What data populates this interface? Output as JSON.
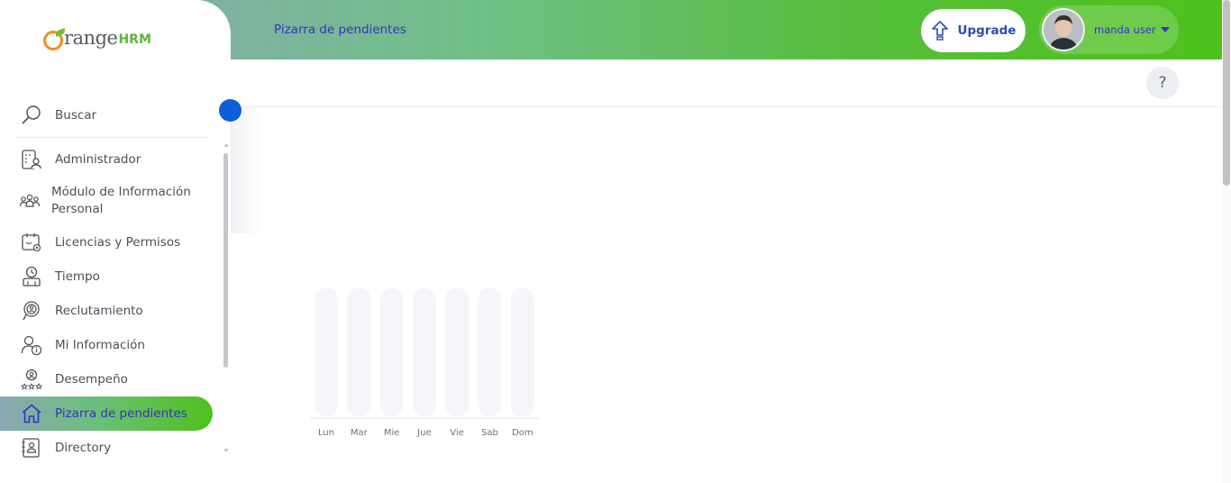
{
  "topbar": {
    "title": "Pizarra de pendientes",
    "upgrade_label": "Upgrade",
    "user_name": "manda user"
  },
  "help": {
    "label": "?"
  },
  "logo": {
    "part1": "range",
    "part2": "HRM"
  },
  "sidebar": {
    "search_label": "Buscar",
    "items": [
      {
        "label": "Administrador",
        "icon": "admin-icon"
      },
      {
        "label": "Módulo de Información Personal",
        "icon": "pim-icon"
      },
      {
        "label": "Licencias y Permisos",
        "icon": "leave-icon"
      },
      {
        "label": "Tiempo",
        "icon": "time-icon"
      },
      {
        "label": "Reclutamiento",
        "icon": "recruitment-icon"
      },
      {
        "label": "Mi Información",
        "icon": "my-info-icon"
      },
      {
        "label": "Desempeño",
        "icon": "performance-icon"
      },
      {
        "label": "Pizarra de pendientes",
        "icon": "home-icon",
        "active": true
      },
      {
        "label": "Directory",
        "icon": "directory-icon"
      }
    ]
  },
  "colors": {
    "accent": "#3d2ec9",
    "collapse": "#0b5fd9",
    "brand_green": "#4ec11c",
    "brand_orange": "#f28c1f"
  },
  "chart_data": {
    "type": "bar",
    "categories": [
      "Lun",
      "Mar",
      "Mie",
      "Jue",
      "Vie",
      "Sab",
      "Dom"
    ],
    "values": [
      0,
      0,
      0,
      0,
      0,
      0,
      0
    ],
    "title": "",
    "xlabel": "",
    "ylabel": ""
  }
}
